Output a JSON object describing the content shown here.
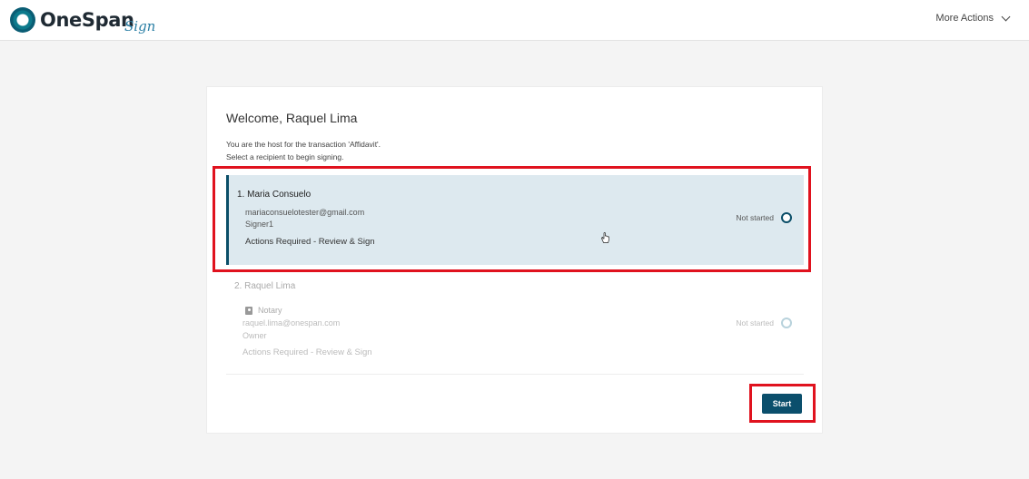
{
  "header": {
    "logo_text": "OneSpan",
    "logo_sub": "Sign",
    "more_actions": "More Actions"
  },
  "welcome": "Welcome, Raquel Lima",
  "subtext": {
    "line1": "You are the host for the transaction 'Affidavit'.",
    "line2": "Select a recipient to begin signing."
  },
  "recipients": [
    {
      "name": "1. Maria Consuelo",
      "email": "mariaconsuelotester@gmail.com",
      "role": "Signer1",
      "actions": "Actions Required - Review & Sign",
      "status": "Not started"
    },
    {
      "name": "2. Raquel Lima",
      "tag": "Notary",
      "email": "raquel.lima@onespan.com",
      "role": "Owner",
      "actions": "Actions Required - Review & Sign",
      "status": "Not started"
    }
  ],
  "start_label": "Start",
  "colors": {
    "accent": "#0b4f6c",
    "selected_bg": "#dde9ef",
    "highlight": "#e0121e"
  }
}
